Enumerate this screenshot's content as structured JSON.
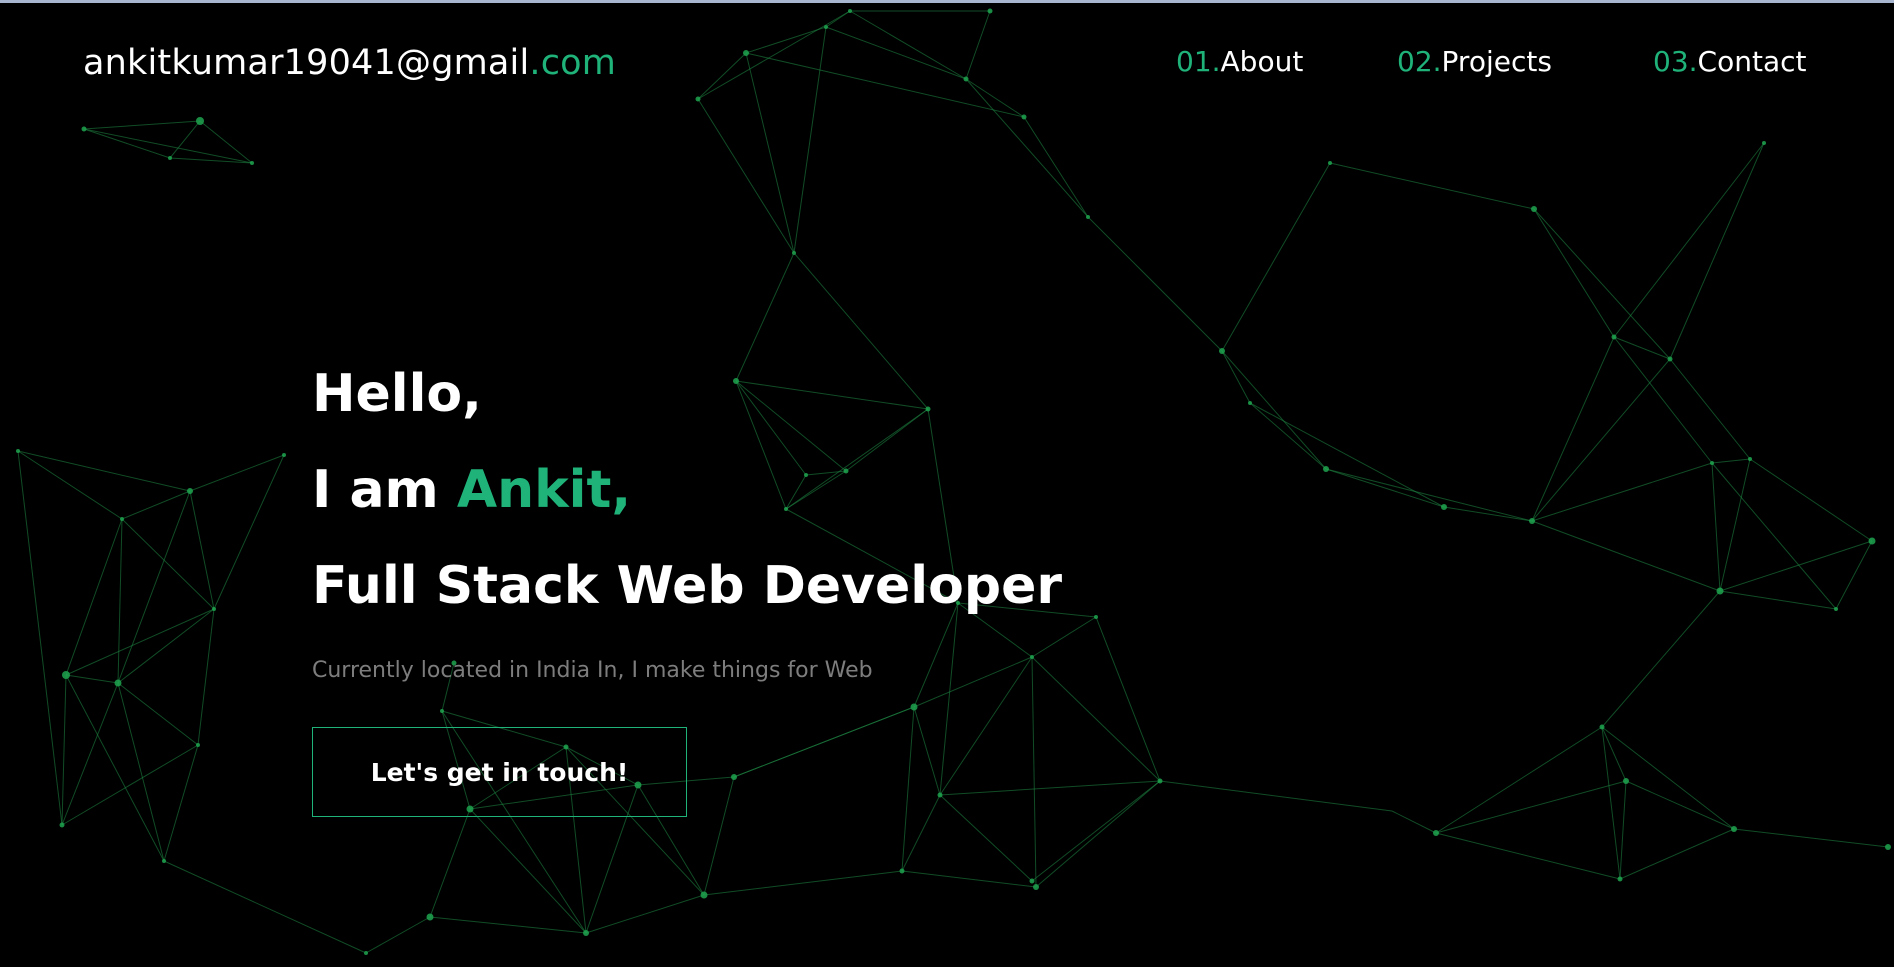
{
  "header": {
    "email_prefix": "ankitkumar19041@gmail",
    "email_suffix": ".com"
  },
  "nav": {
    "items": [
      {
        "number": "01.",
        "label": "About"
      },
      {
        "number": "02.",
        "label": "Projects"
      },
      {
        "number": "03.",
        "label": "Contact"
      }
    ]
  },
  "hero": {
    "greeting": "Hello,",
    "intro_prefix": "I am ",
    "name": "Ankit,",
    "role": "Full Stack Web Developer",
    "tagline": "Currently located in India In, I make things for Web",
    "cta_label": "Let's get in touch!"
  },
  "colors": {
    "background": "#000000",
    "accent": "#1fb37a",
    "network": "#1f8a45",
    "tagline": "#7d7d7d",
    "text": "#ffffff"
  }
}
